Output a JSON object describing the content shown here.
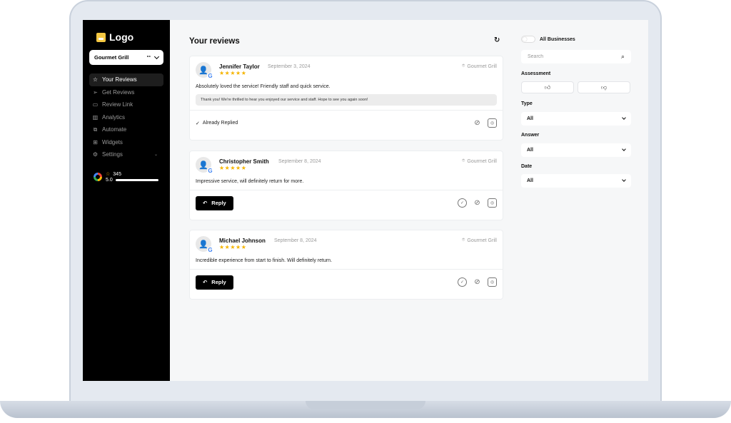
{
  "sidebar": {
    "logo_text": "Logo",
    "business": {
      "name": "Gourmet Grill",
      "icon_text": "ᐤᐤ"
    },
    "nav": [
      {
        "label": "Your Reviews",
        "icon": "star-outline-icon",
        "glyph": "☆"
      },
      {
        "label": "Get Reviews",
        "icon": "send-icon",
        "glyph": "➢"
      },
      {
        "label": "Review Link",
        "icon": "monitor-icon",
        "glyph": "▭"
      },
      {
        "label": "Analytics",
        "icon": "bar-chart-icon",
        "glyph": "▥"
      },
      {
        "label": "Automate",
        "icon": "automate-icon",
        "glyph": "⧉"
      },
      {
        "label": "Widgets",
        "icon": "grid-icon",
        "glyph": "⊞"
      },
      {
        "label": "Settings",
        "icon": "gear-icon",
        "glyph": "⚙"
      }
    ],
    "rating": {
      "count": "345",
      "score": "5.0"
    }
  },
  "main": {
    "title": "Your reviews",
    "reviews": [
      {
        "name": "Jennifer Taylor",
        "date": "September 3, 2024",
        "location": "Gourmet Grill",
        "stars": "★★★★★",
        "text": "Absolutely loved the service! Friendly staff and quick service.",
        "reply": "Thank you! We're thrilled to hear you enjoyed our service and staff. Hope to see you again soon!",
        "status": "Already Replied"
      },
      {
        "name": "Christopher Smith",
        "date": "September 8, 2024",
        "location": "Gourmet Grill",
        "stars": "★★★★★",
        "text": "Impressive service, will definitely return for more.",
        "reply_button": "Reply"
      },
      {
        "name": "Michael Johnson",
        "date": "September 8, 2024",
        "location": "Gourmet Grill",
        "stars": "★★★★★",
        "text": "Incredible experience from start to finish. Will definitely return.",
        "reply_button": "Reply"
      }
    ]
  },
  "filters": {
    "all_businesses_label": "All Businesses",
    "search_placeholder": "Search",
    "assessment_label": "Assessment",
    "type_label": "Type",
    "type_value": "All",
    "answer_label": "Answer",
    "answer_value": "All",
    "date_label": "Date",
    "date_value": "All"
  },
  "colors": {
    "star": "#f5b400",
    "sidebar_bg": "#000000",
    "logo_accent": "#f5c842"
  }
}
